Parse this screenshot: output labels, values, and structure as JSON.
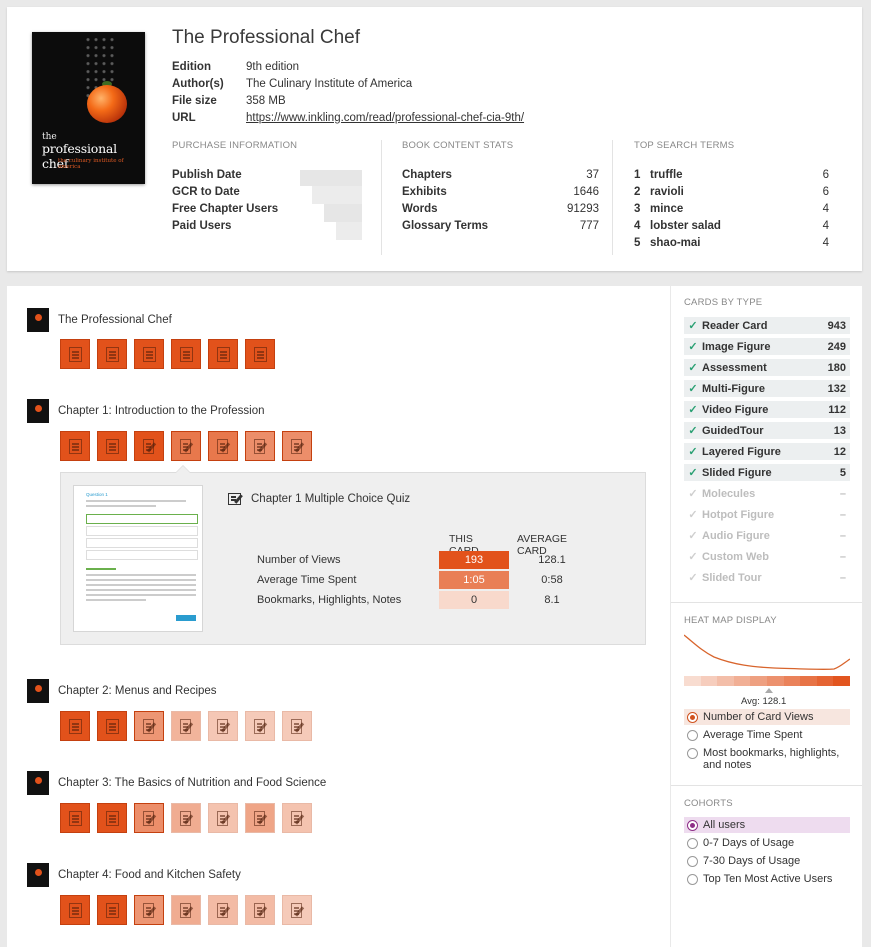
{
  "book": {
    "title": "The Professional Chef",
    "cover": {
      "line1": "the",
      "line2": "professional chef",
      "line3": "the culinary institute of america"
    },
    "meta": [
      {
        "key": "Edition",
        "value": "9th edition"
      },
      {
        "key": "Author(s)",
        "value": "The Culinary Institute of America"
      },
      {
        "key": "File size",
        "value": "358 MB"
      },
      {
        "key": "URL",
        "value": "https://www.inkling.com/read/professional-chef-cia-9th/"
      }
    ]
  },
  "purchase": {
    "label": "PURCHASE INFORMATION",
    "rows": [
      "Publish Date",
      "GCR to Date",
      "Free Chapter Users",
      "Paid Users"
    ]
  },
  "content_stats": {
    "label": "BOOK CONTENT STATS",
    "rows": [
      {
        "name": "Chapters",
        "value": "37"
      },
      {
        "name": "Exhibits",
        "value": "1646"
      },
      {
        "name": "Words",
        "value": "91293"
      },
      {
        "name": "Glossary Terms",
        "value": "777"
      }
    ]
  },
  "search_terms": {
    "label": "TOP SEARCH TERMS",
    "rows": [
      {
        "rank": "1",
        "term": "truffle",
        "count": "6"
      },
      {
        "rank": "2",
        "term": "ravioli",
        "count": "6"
      },
      {
        "rank": "3",
        "term": "mince",
        "count": "4"
      },
      {
        "rank": "4",
        "term": "lobster salad",
        "count": "4"
      },
      {
        "rank": "5",
        "term": "shao-mai",
        "count": "4"
      }
    ]
  },
  "chapters": [
    {
      "title": "The Professional Chef",
      "cards": [
        {
          "type": "page",
          "heat": 1.0
        },
        {
          "type": "page",
          "heat": 1.0
        },
        {
          "type": "page",
          "heat": 1.0
        },
        {
          "type": "page",
          "heat": 1.0
        },
        {
          "type": "page",
          "heat": 1.0
        },
        {
          "type": "page",
          "heat": 1.0
        }
      ]
    },
    {
      "title": "Chapter 1: Introduction to the Profession",
      "cards": [
        {
          "type": "page",
          "heat": 1.0
        },
        {
          "type": "page",
          "heat": 1.0
        },
        {
          "type": "edit",
          "heat": 1.0
        },
        {
          "type": "edit",
          "heat": 0.75
        },
        {
          "type": "edit",
          "heat": 0.75
        },
        {
          "type": "edit",
          "heat": 0.6
        },
        {
          "type": "edit",
          "heat": 0.6
        }
      ]
    },
    {
      "title": "Chapter 2: Menus and Recipes",
      "cards": [
        {
          "type": "page",
          "heat": 1.0
        },
        {
          "type": "page",
          "heat": 1.0
        },
        {
          "type": "edit",
          "heat": 0.55
        },
        {
          "type": "edit",
          "heat": 0.35
        },
        {
          "type": "edit",
          "heat": 0.22
        },
        {
          "type": "edit",
          "heat": 0.2
        },
        {
          "type": "edit",
          "heat": 0.2
        }
      ]
    },
    {
      "title": "Chapter 3: The Basics of Nutrition and Food Science",
      "cards": [
        {
          "type": "page",
          "heat": 1.0
        },
        {
          "type": "page",
          "heat": 1.0
        },
        {
          "type": "edit",
          "heat": 0.6
        },
        {
          "type": "edit",
          "heat": 0.4
        },
        {
          "type": "edit",
          "heat": 0.25
        },
        {
          "type": "edit",
          "heat": 0.45
        },
        {
          "type": "edit",
          "heat": 0.25
        }
      ]
    },
    {
      "title": "Chapter 4: Food and Kitchen Safety",
      "cards": [
        {
          "type": "page",
          "heat": 1.0
        },
        {
          "type": "page",
          "heat": 1.0
        },
        {
          "type": "edit",
          "heat": 0.55
        },
        {
          "type": "edit",
          "heat": 0.4
        },
        {
          "type": "edit",
          "heat": 0.3
        },
        {
          "type": "edit",
          "heat": 0.3
        },
        {
          "type": "edit",
          "heat": 0.2
        }
      ]
    }
  ],
  "detail": {
    "title": "Chapter 1 Multiple Choice Quiz",
    "preview_heading": "Question 1",
    "col_this": "THIS CARD",
    "col_avg": "AVERAGE CARD",
    "rows": [
      {
        "label": "Number of Views",
        "this": "193",
        "avg": "128.1",
        "heat": 1.0
      },
      {
        "label": "Average Time Spent",
        "this": "1:05",
        "avg": "0:58",
        "heat": 0.7
      },
      {
        "label": "Bookmarks, Highlights, Notes",
        "this": "0",
        "avg": "8.1",
        "heat": 0.1
      }
    ]
  },
  "cards_by_type": {
    "label": "CARDS BY TYPE",
    "items": [
      {
        "name": "Reader Card",
        "count": "943",
        "enabled": true
      },
      {
        "name": "Image Figure",
        "count": "249",
        "enabled": true
      },
      {
        "name": "Assessment",
        "count": "180",
        "enabled": true
      },
      {
        "name": "Multi-Figure",
        "count": "132",
        "enabled": true
      },
      {
        "name": "Video Figure",
        "count": "112",
        "enabled": true
      },
      {
        "name": "GuidedTour",
        "count": "13",
        "enabled": true
      },
      {
        "name": "Layered Figure",
        "count": "12",
        "enabled": true
      },
      {
        "name": "Slided Figure",
        "count": "5",
        "enabled": true
      },
      {
        "name": "Molecules",
        "count": "–",
        "enabled": false
      },
      {
        "name": "Hotpot Figure",
        "count": "–",
        "enabled": false
      },
      {
        "name": "Audio Figure",
        "count": "–",
        "enabled": false
      },
      {
        "name": "Custom Web",
        "count": "–",
        "enabled": false
      },
      {
        "name": "Slided Tour",
        "count": "–",
        "enabled": false
      }
    ]
  },
  "heat_map": {
    "label": "HEAT MAP DISPLAY",
    "avg_label": "Avg: 128.1",
    "options": [
      {
        "label": "Number of Card Views",
        "selected": true
      },
      {
        "label": "Average Time Spent",
        "selected": false
      },
      {
        "label": "Most bookmarks, highlights, and notes",
        "selected": false
      }
    ]
  },
  "cohorts": {
    "label": "COHORTS",
    "options": [
      {
        "label": "All users",
        "selected": true
      },
      {
        "label": "0-7 Days of Usage",
        "selected": false
      },
      {
        "label": "7-30 Days of Usage",
        "selected": false
      },
      {
        "label": "Top Ten Most Active Users",
        "selected": false
      }
    ]
  },
  "colors": {
    "accent": "#e2521b",
    "check": "#2aa073",
    "cohort": "#8e2e87"
  }
}
